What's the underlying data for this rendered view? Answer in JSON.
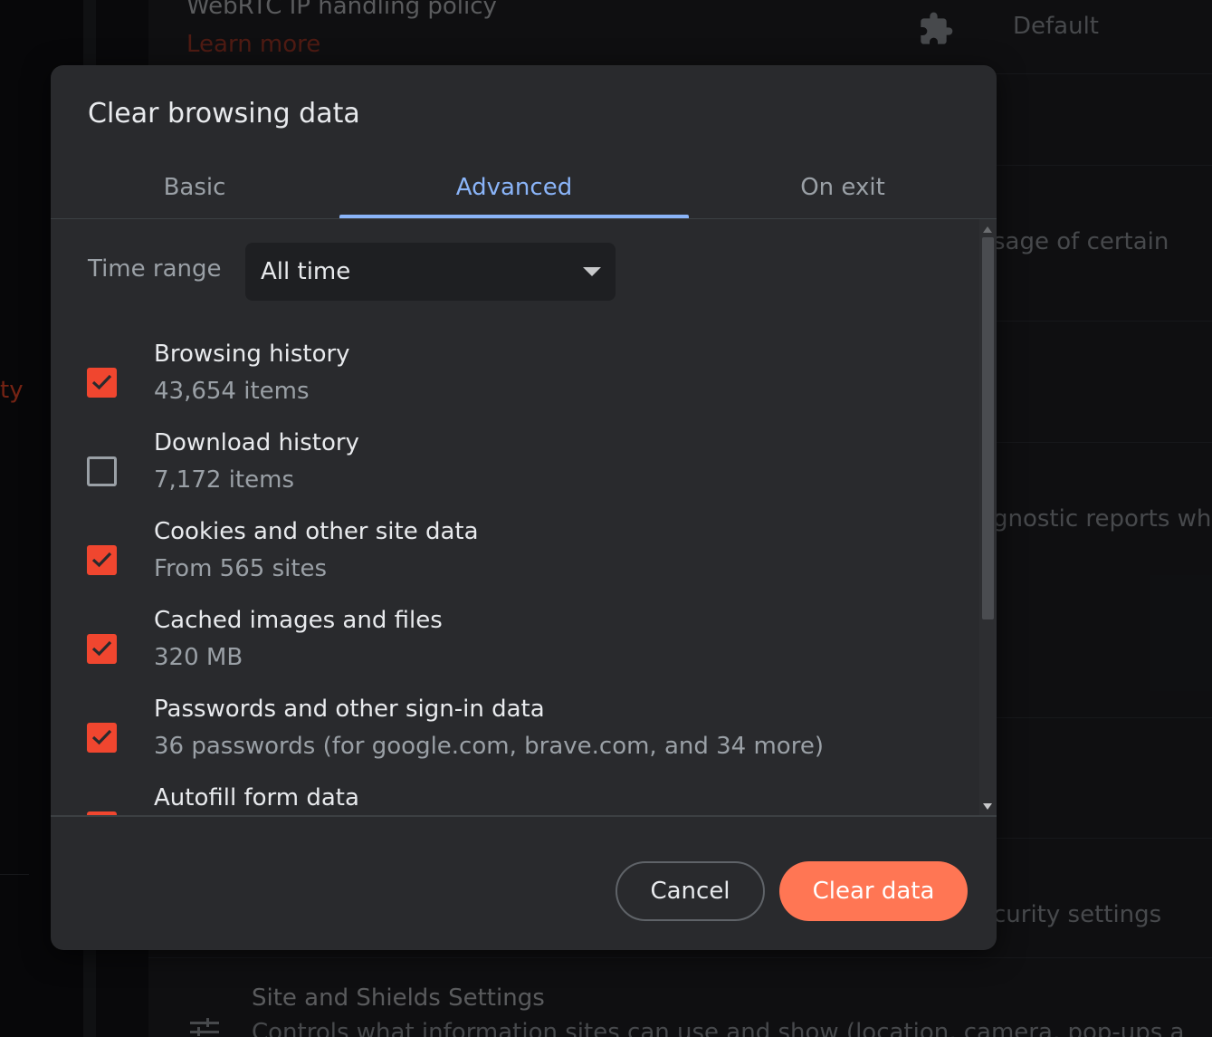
{
  "background": {
    "top_setting_title": "WebRTC IP handling policy",
    "top_setting_link": "Learn more",
    "top_setting_value": "Default",
    "left_partial_text": "ty",
    "partial_text_1": "sage of certain",
    "partial_text_2": "gnostic reports wh",
    "partial_text_3": "curity settings",
    "site_settings_title": "Site and Shields Settings",
    "site_settings_sub": "Controls what information sites can use and show (location, camera, pop-ups a",
    "icons": [
      "puzzle-icon",
      "tune-icon"
    ]
  },
  "dialog": {
    "title": "Clear browsing data",
    "tabs": [
      {
        "label": "Basic",
        "active": false
      },
      {
        "label": "Advanced",
        "active": true
      },
      {
        "label": "On exit",
        "active": false
      }
    ],
    "time_range": {
      "label": "Time range",
      "selected": "All time"
    },
    "items": [
      {
        "title": "Browsing history",
        "subtitle": "43,654 items",
        "checked": true
      },
      {
        "title": "Download history",
        "subtitle": "7,172 items",
        "checked": false
      },
      {
        "title": "Cookies and other site data",
        "subtitle": "From 565 sites",
        "checked": true
      },
      {
        "title": "Cached images and files",
        "subtitle": "320 MB",
        "checked": true
      },
      {
        "title": "Passwords and other sign-in data",
        "subtitle": "36 passwords (for google.com, brave.com, and 34 more)",
        "checked": true
      },
      {
        "title": "Autofill form data",
        "subtitle": "",
        "checked": true
      }
    ],
    "buttons": {
      "cancel": "Cancel",
      "clear": "Clear data"
    },
    "colors": {
      "accent_tab": "#8ab4f8",
      "checkbox": "#f0462f",
      "primary_button": "#ff7654"
    }
  }
}
